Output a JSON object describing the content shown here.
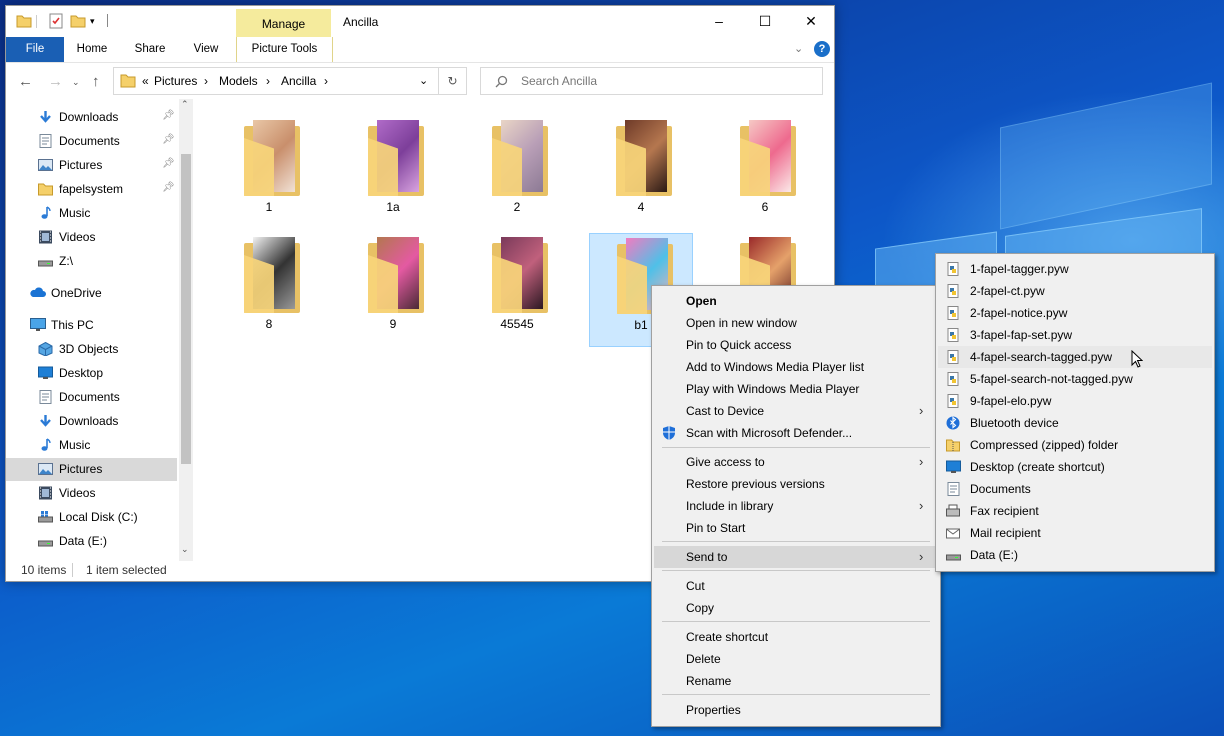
{
  "window": {
    "title": "Ancilla",
    "contextual_tab": "Manage",
    "ribbon_tabs": [
      "File",
      "Home",
      "Share",
      "View",
      "Picture Tools"
    ],
    "controls": {
      "minimize": "–",
      "maximize": "☐",
      "close": "✕",
      "help": "?"
    }
  },
  "address": {
    "prefix": "«",
    "crumbs": [
      "Pictures",
      "Models",
      "Ancilla"
    ],
    "search_placeholder": "Search Ancilla"
  },
  "nav": {
    "items": [
      {
        "label": "Downloads",
        "icon": "download-arrow-icon",
        "pinned": true
      },
      {
        "label": "Documents",
        "icon": "document-icon",
        "pinned": true
      },
      {
        "label": "Pictures",
        "icon": "pictures-icon",
        "pinned": true
      },
      {
        "label": "fapelsystem",
        "icon": "folder-icon",
        "pinned": true
      },
      {
        "label": "Music",
        "icon": "music-note-icon",
        "pinned": false
      },
      {
        "label": "Videos",
        "icon": "film-icon",
        "pinned": false
      },
      {
        "label": "Z:\\",
        "icon": "drive-icon",
        "pinned": false
      },
      {
        "label": "OneDrive",
        "icon": "cloud-icon",
        "pinned": false
      },
      {
        "label": "This PC",
        "icon": "monitor-icon",
        "pinned": false
      },
      {
        "label": "3D Objects",
        "icon": "cube-icon",
        "pinned": false
      },
      {
        "label": "Desktop",
        "icon": "desktop-icon",
        "pinned": false
      },
      {
        "label": "Documents",
        "icon": "document-icon",
        "pinned": false
      },
      {
        "label": "Downloads",
        "icon": "download-arrow-icon",
        "pinned": false
      },
      {
        "label": "Music",
        "icon": "music-note-icon",
        "pinned": false
      },
      {
        "label": "Pictures",
        "icon": "pictures-icon",
        "pinned": false,
        "selected": true
      },
      {
        "label": "Videos",
        "icon": "film-icon",
        "pinned": false
      },
      {
        "label": "Local Disk (C:)",
        "icon": "windows-drive-icon",
        "pinned": false
      },
      {
        "label": "Data (E:)",
        "icon": "drive-icon",
        "pinned": false
      }
    ]
  },
  "folders": [
    {
      "name": "1"
    },
    {
      "name": "1a"
    },
    {
      "name": "2"
    },
    {
      "name": "4"
    },
    {
      "name": "6"
    },
    {
      "name": "8"
    },
    {
      "name": "9"
    },
    {
      "name": "45545"
    },
    {
      "name": "b1",
      "selected": true
    },
    {
      "name": ""
    }
  ],
  "status": {
    "count": "10 items",
    "selection": "1 item selected"
  },
  "context_menu": {
    "items": [
      {
        "label": "Open",
        "bold": true
      },
      {
        "label": "Open in new window"
      },
      {
        "label": "Pin to Quick access"
      },
      {
        "label": "Add to Windows Media Player list"
      },
      {
        "label": "Play with Windows Media Player"
      },
      {
        "label": "Cast to Device",
        "submenu": true
      },
      {
        "label": "Scan with Microsoft Defender...",
        "icon": "defender-shield-icon"
      },
      {
        "label": "Give access to",
        "submenu": true
      },
      {
        "label": "Restore previous versions"
      },
      {
        "label": "Include in library",
        "submenu": true
      },
      {
        "label": "Pin to Start"
      },
      {
        "label": "Send to",
        "submenu": true,
        "highlighted": true
      },
      {
        "label": "Cut"
      },
      {
        "label": "Copy"
      },
      {
        "label": "Create shortcut"
      },
      {
        "label": "Delete"
      },
      {
        "label": "Rename"
      },
      {
        "label": "Properties"
      }
    ]
  },
  "send_to": {
    "items": [
      {
        "label": "1-fapel-tagger.pyw",
        "icon": "python-file-icon"
      },
      {
        "label": "2-fapel-ct.pyw",
        "icon": "python-file-icon"
      },
      {
        "label": "2-fapel-notice.pyw",
        "icon": "python-file-icon"
      },
      {
        "label": "3-fapel-fap-set.pyw",
        "icon": "python-file-icon"
      },
      {
        "label": "4-fapel-search-tagged.pyw",
        "icon": "python-file-icon",
        "highlighted": true
      },
      {
        "label": "5-fapel-search-not-tagged.pyw",
        "icon": "python-file-icon"
      },
      {
        "label": "9-fapel-elo.pyw",
        "icon": "python-file-icon"
      },
      {
        "label": "Bluetooth device",
        "icon": "bluetooth-icon"
      },
      {
        "label": "Compressed (zipped) folder",
        "icon": "zip-folder-icon"
      },
      {
        "label": "Desktop (create shortcut)",
        "icon": "desktop-icon"
      },
      {
        "label": "Documents",
        "icon": "document-icon"
      },
      {
        "label": "Fax recipient",
        "icon": "fax-icon"
      },
      {
        "label": "Mail recipient",
        "icon": "mail-icon"
      },
      {
        "label": "Data (E:)",
        "icon": "drive-icon"
      }
    ]
  }
}
